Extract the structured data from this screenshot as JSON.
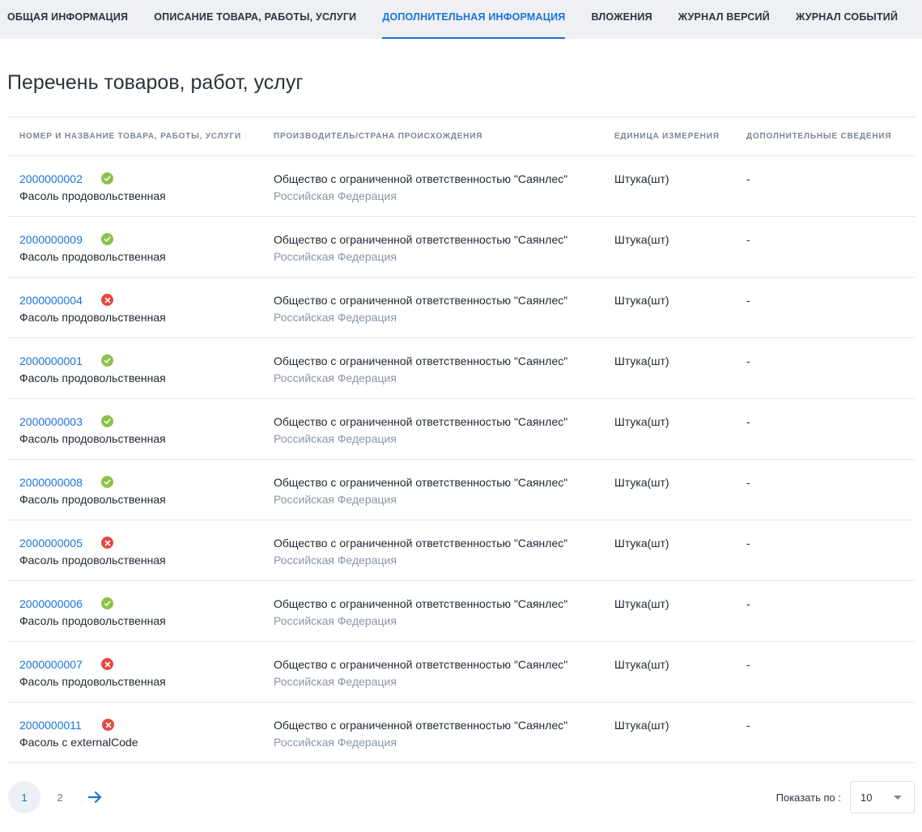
{
  "tabs": [
    {
      "label": "ОБЩАЯ ИНФОРМАЦИЯ",
      "active": false
    },
    {
      "label": "ОПИСАНИЕ ТОВАРА, РАБОТЫ, УСЛУГИ",
      "active": false
    },
    {
      "label": "ДОПОЛНИТЕЛЬНАЯ ИНФОРМАЦИЯ",
      "active": true
    },
    {
      "label": "ВЛОЖЕНИЯ",
      "active": false
    },
    {
      "label": "ЖУРНАЛ ВЕРСИЙ",
      "active": false
    },
    {
      "label": "ЖУРНАЛ СОБЫТИЙ",
      "active": false
    }
  ],
  "page_title": "Перечень товаров, работ, услуг",
  "table": {
    "headers": [
      "НОМЕР И НАЗВАНИЕ ТОВАРА, РАБОТЫ, УСЛУГИ",
      "ПРОИЗВОДИТЕЛЬ/СТРАНА ПРОИСХОЖДЕНИЯ",
      "ЕДИНИЦА ИЗМЕРЕНИЯ",
      "ДОПОЛНИТЕЛЬНЫЕ СВЕДЕНИЯ"
    ],
    "rows": [
      {
        "code": "2000000002",
        "status": "ok",
        "name": "Фасоль продовольственная",
        "manufacturer": "Общество с ограниченной ответственностью \"Саянлес\"",
        "country": "Российская Федерация",
        "unit": "Штука(шт)",
        "extra": "-"
      },
      {
        "code": "2000000009",
        "status": "ok",
        "name": "Фасоль продовольственная",
        "manufacturer": "Общество с ограниченной ответственностью \"Саянлес\"",
        "country": "Российская Федерация",
        "unit": "Штука(шт)",
        "extra": "-"
      },
      {
        "code": "2000000004",
        "status": "error",
        "name": "Фасоль продовольственная",
        "manufacturer": "Общество с ограниченной ответственностью \"Саянлес\"",
        "country": "Российская Федерация",
        "unit": "Штука(шт)",
        "extra": "-"
      },
      {
        "code": "2000000001",
        "status": "ok",
        "name": "Фасоль продовольственная",
        "manufacturer": "Общество с ограниченной ответственностью \"Саянлес\"",
        "country": "Российская Федерация",
        "unit": "Штука(шт)",
        "extra": "-"
      },
      {
        "code": "2000000003",
        "status": "ok",
        "name": "Фасоль продовольственная",
        "manufacturer": "Общество с ограниченной ответственностью \"Саянлес\"",
        "country": "Российская Федерация",
        "unit": "Штука(шт)",
        "extra": "-"
      },
      {
        "code": "2000000008",
        "status": "ok",
        "name": "Фасоль продовольственная",
        "manufacturer": "Общество с ограниченной ответственностью \"Саянлес\"",
        "country": "Российская Федерация",
        "unit": "Штука(шт)",
        "extra": "-"
      },
      {
        "code": "2000000005",
        "status": "error",
        "name": "Фасоль продовольственная",
        "manufacturer": "Общество с ограниченной ответственностью \"Саянлес\"",
        "country": "Российская Федерация",
        "unit": "Штука(шт)",
        "extra": "-"
      },
      {
        "code": "2000000006",
        "status": "ok",
        "name": "Фасоль продовольственная",
        "manufacturer": "Общество с ограниченной ответственностью \"Саянлес\"",
        "country": "Российская Федерация",
        "unit": "Штука(шт)",
        "extra": "-"
      },
      {
        "code": "2000000007",
        "status": "error",
        "name": "Фасоль продовольственная",
        "manufacturer": "Общество с ограниченной ответственностью \"Саянлес\"",
        "country": "Российская Федерация",
        "unit": "Штука(шт)",
        "extra": "-"
      },
      {
        "code": "2000000011",
        "status": "error",
        "name": "Фасоль с externalCode",
        "manufacturer": "Общество с ограниченной ответственностью \"Саянлес\"",
        "country": "Российская Федерация",
        "unit": "Штука(шт)",
        "extra": "-"
      }
    ]
  },
  "pagination": {
    "pages": [
      "1",
      "2"
    ],
    "current": "1",
    "next_icon": "arrow-right-icon",
    "per_page_label": "Показать по :",
    "per_page_value": "10"
  },
  "colors": {
    "accent": "#1a73d9",
    "ok": "#8bc34a",
    "error": "#e5483f"
  }
}
